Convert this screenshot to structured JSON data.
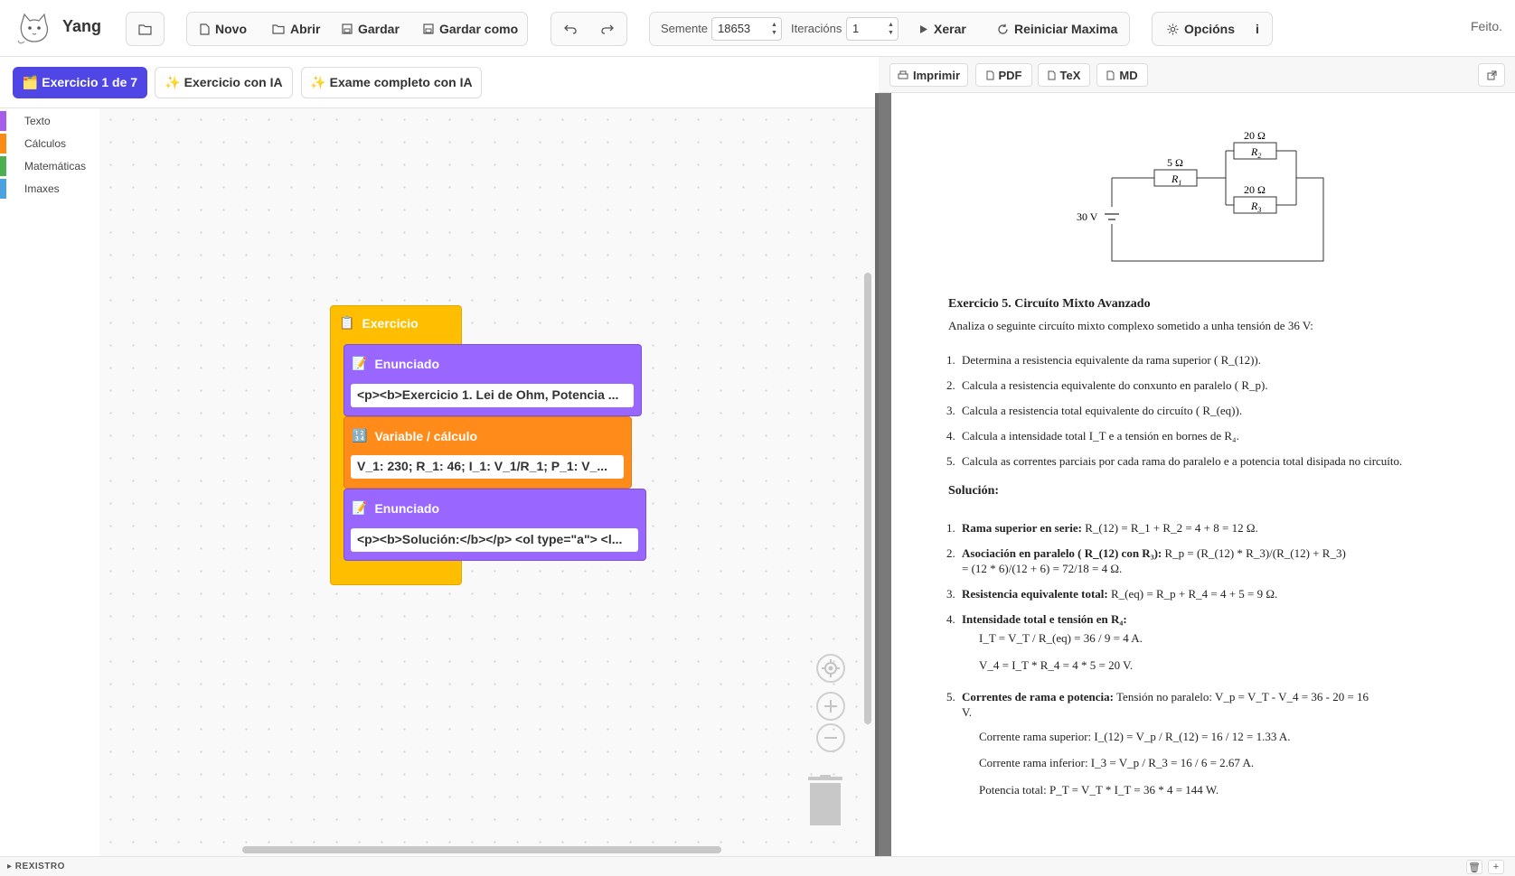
{
  "app": {
    "title": "Yang",
    "status": "Feito."
  },
  "toolbar": {
    "novo": "Novo",
    "abrir": "Abrir",
    "gardar": "Gardar",
    "gardar_como": "Gardar como",
    "semente_label": "Semente",
    "semente_value": "18653",
    "iteracions_label": "Iteracións",
    "iteracions_value": "1",
    "xerar": "Xerar",
    "reiniciar": "Reiniciar Maxima",
    "opcions": "Opcións",
    "info": "i"
  },
  "tabs": {
    "exercicio": "🗂️ Exercicio 1 de 7",
    "exercicio_ia": "✨ Exercicio con IA",
    "exame_ia": "✨ Exame completo con IA"
  },
  "output_toolbar": {
    "imprimir": "Imprimir",
    "pdf": "PDF",
    "tex": "TeX",
    "md": "MD"
  },
  "toolbox": {
    "categories": [
      {
        "label": "Texto",
        "color": "#a55eea"
      },
      {
        "label": "Cálculos",
        "color": "#fa8c16"
      },
      {
        "label": "Matemáticas",
        "color": "#4caf50"
      },
      {
        "label": "Imaxes",
        "color": "#4aa3df"
      }
    ]
  },
  "blocks": {
    "exercicio": {
      "label": "Exercicio",
      "color": "#ffbf00",
      "icon": "📋"
    },
    "enunciado1": {
      "label": "Enunciado",
      "color": "#9966ff",
      "icon": "📝",
      "field": "<p><b>Exercicio 1. Lei de Ohm, Potencia ..."
    },
    "variable": {
      "label": "Variable / cálculo",
      "color": "#ff8c1a",
      "icon": "🔢",
      "field": "V_1: 230; R_1: 46; I_1: V_1/R_1; P_1: V_..."
    },
    "enunciado2": {
      "label": "Enunciado",
      "color": "#9966ff",
      "icon": "📝",
      "field": "<p><b>Solución:</b></p> <ol type=\"a\"> <l..."
    }
  },
  "circuit": {
    "r1_value": "5 Ω",
    "r1_label": "R",
    "r1_sub": "1",
    "r2_value": "20 Ω",
    "r2_label": "R",
    "r2_sub": "2",
    "r3_value": "20 Ω",
    "r3_label": "R",
    "r3_sub": "3",
    "source": "30 V"
  },
  "document": {
    "exercise_title": "Exercicio 5.  Circuíto Mixto Avanzado",
    "intro": "Analiza o seguinte circuíto mixto complexo sometido a unha tensión de 36 V:",
    "questions": [
      {
        "n": "1.",
        "text": "Determina a resistencia equivalente da rama superior ( R_(12))."
      },
      {
        "n": "2.",
        "text": "Calcula a resistencia equivalente do conxunto en paralelo ( R_p)."
      },
      {
        "n": "3.",
        "text": "Calcula a resistencia total equivalente do circuíto ( R_(eq))."
      },
      {
        "n": "4.",
        "text": "Calcula a intensidade total I_T e a tensión en bornes de R₄."
      },
      {
        "n": "5.",
        "text": "Calcula as correntes parciais por cada rama do paralelo e a potencia total disipada no circuíto."
      }
    ],
    "solution_title": "Solución:",
    "solutions": [
      {
        "n": "1.",
        "bold": "Rama superior en serie:",
        "text": " R_(12) = R_1 + R_2 = 4 + 8 = 12 Ω."
      },
      {
        "n": "2.",
        "bold": "Asociación en paralelo ( R_(12) con R₃):",
        "text": " R_p = (R_(12) * R_3)/(R_(12) + R_3)",
        "cont": "= (12 * 6)/(12 + 6) = 72/18 = 4 Ω."
      },
      {
        "n": "3.",
        "bold": "Resistencia equivalente total:",
        "text": " R_(eq) = R_p + R_4 = 4 + 5 = 9 Ω."
      },
      {
        "n": "4.",
        "bold": "Intensidade total e tensión en R₄:",
        "text": ""
      },
      {
        "n": "5.",
        "bold": "Correntes de rama e potencia:",
        "text": " Tensión no paralelo: V_p = V_T - V_4 = 36 - 20 = 16",
        "cont": "V."
      }
    ],
    "sol4_lines": [
      "I_T = V_T / R_(eq) = 36 / 9 = 4 A.",
      "V_4 = I_T * R_4 = 4 * 5 = 20 V."
    ],
    "sol5_lines": [
      "Corrente rama superior: I_(12) = V_p / R_(12) = 16 / 12 = 1.33 A.",
      "Corrente rama inferior: I_3 = V_p / R_3 = 16 / 6 = 2.67 A.",
      "Potencia total: P_T = V_T * I_T = 36 * 4 = 144 W."
    ]
  },
  "footer": {
    "log_label": "▸ REXISTRO",
    "trash": "🗑",
    "add": "+"
  }
}
